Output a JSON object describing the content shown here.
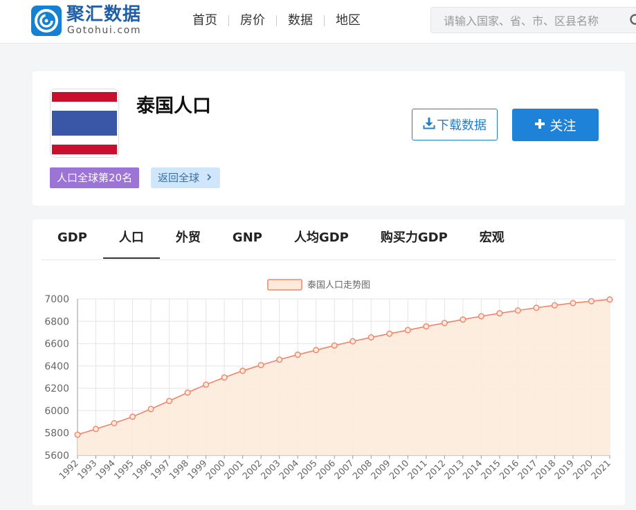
{
  "header": {
    "logo_title": "聚汇数据",
    "logo_sub": "Gotohui.com",
    "nav": [
      "首页",
      "房价",
      "数据",
      "地区"
    ],
    "search_placeholder": "请输入国家、省、市、区县名称"
  },
  "country": {
    "title": "泰国人口",
    "download_label": "下载数据",
    "follow_label": "关注",
    "rank_badge": "人口全球第20名",
    "back_label": "返回全球",
    "flag_colors": [
      "#c8102e",
      "#ffffff",
      "#3a56a6"
    ]
  },
  "tabs": [
    {
      "label": "GDP",
      "active": false
    },
    {
      "label": "人口",
      "active": true
    },
    {
      "label": "外贸",
      "active": false
    },
    {
      "label": "GNP",
      "active": false
    },
    {
      "label": "人均GDP",
      "active": false
    },
    {
      "label": "购买力GDP",
      "active": false
    },
    {
      "label": "宏观",
      "active": false
    }
  ],
  "colors": {
    "brand": "#1d82d8",
    "series_line": "#f2826a",
    "series_fill": "#fcebdb"
  },
  "chart_data": {
    "type": "area",
    "title": "",
    "legend": [
      "泰国人口走势图"
    ],
    "legend_position": "top-center",
    "grid": true,
    "xlabel": "",
    "ylabel": "",
    "ylim": [
      5600,
      7000
    ],
    "yticks": [
      5600,
      5800,
      6000,
      6200,
      6400,
      6600,
      6800,
      7000
    ],
    "categories": [
      "1992",
      "1993",
      "1994",
      "1995",
      "1996",
      "1997",
      "1998",
      "1999",
      "2000",
      "2001",
      "2002",
      "2003",
      "2004",
      "2005",
      "2006",
      "2007",
      "2008",
      "2009",
      "2010",
      "2011",
      "2012",
      "2013",
      "2014",
      "2015",
      "2016",
      "2017",
      "2018",
      "2019",
      "2020",
      "2021"
    ],
    "series": [
      {
        "name": "泰国人口走势图",
        "values": [
          5785,
          5836,
          5888,
          5946,
          6015,
          6087,
          6162,
          6233,
          6297,
          6357,
          6408,
          6457,
          6501,
          6542,
          6583,
          6621,
          6656,
          6689,
          6721,
          6754,
          6785,
          6816,
          6845,
          6872,
          6897,
          6921,
          6943,
          6963,
          6980,
          6995
        ]
      }
    ]
  }
}
